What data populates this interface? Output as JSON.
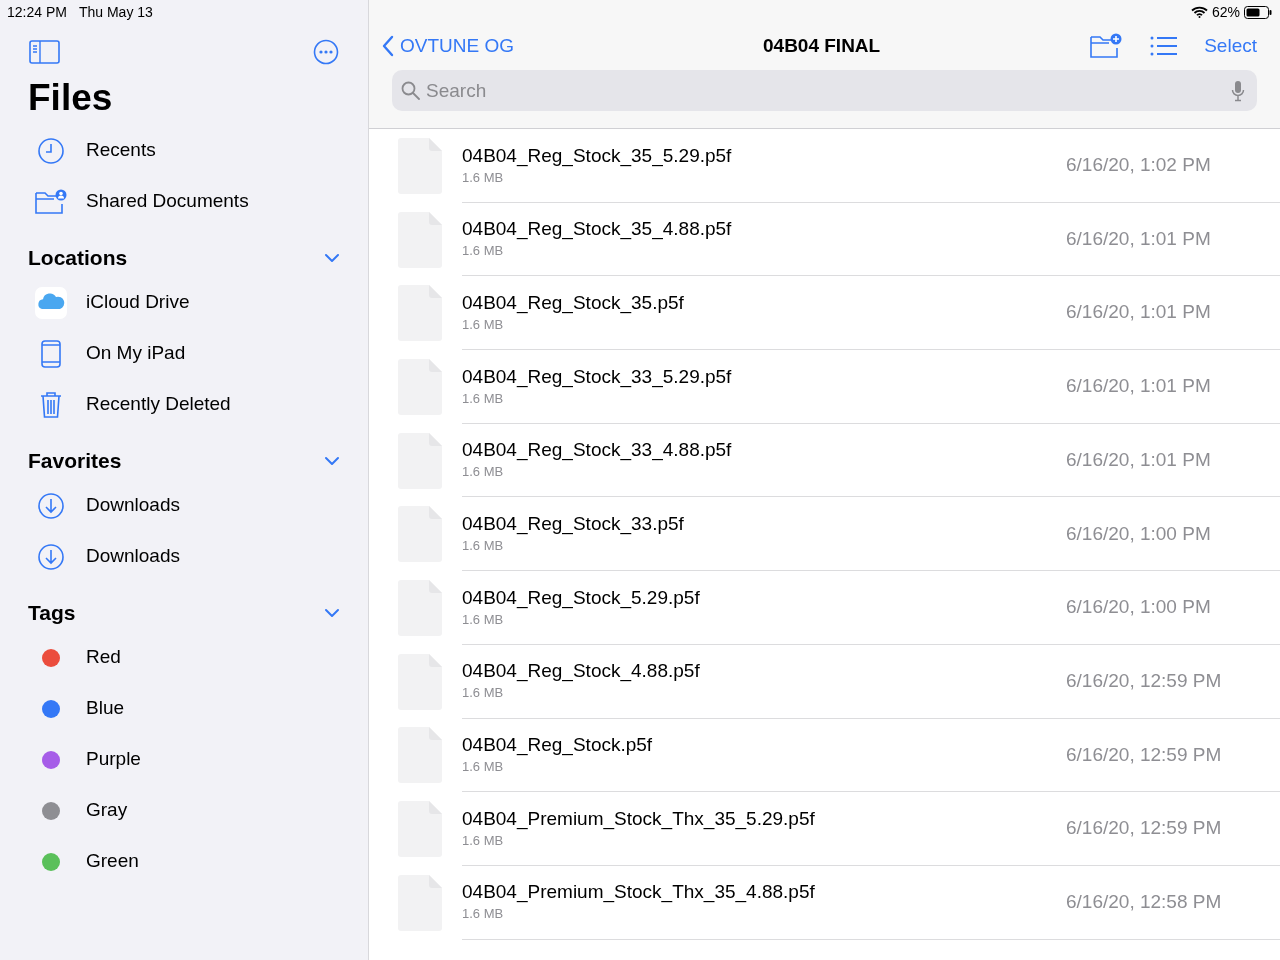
{
  "status_bar": {
    "time": "12:24 PM",
    "date": "Thu May 13",
    "battery": "62%"
  },
  "sidebar": {
    "title": "Files",
    "top_items": [
      {
        "kind": "clock",
        "label": "Recents"
      },
      {
        "kind": "shared",
        "label": "Shared Documents"
      }
    ],
    "sections": [
      {
        "title": "Locations",
        "expanded": true,
        "items": [
          {
            "kind": "icloud",
            "label": "iCloud Drive"
          },
          {
            "kind": "ipad",
            "label": "On My iPad"
          },
          {
            "kind": "trash",
            "label": "Recently Deleted"
          }
        ]
      },
      {
        "title": "Favorites",
        "expanded": true,
        "items": [
          {
            "kind": "download",
            "label": "Downloads"
          },
          {
            "kind": "download",
            "label": "Downloads"
          }
        ]
      },
      {
        "title": "Tags",
        "expanded": true,
        "items": [
          {
            "kind": "tag",
            "label": "Red",
            "color": "#eb4d3d"
          },
          {
            "kind": "tag",
            "label": "Blue",
            "color": "#3478f6"
          },
          {
            "kind": "tag",
            "label": "Purple",
            "color": "#a65de8"
          },
          {
            "kind": "tag",
            "label": "Gray",
            "color": "#8e8e93"
          },
          {
            "kind": "tag",
            "label": "Green",
            "color": "#5ac05a"
          }
        ]
      }
    ]
  },
  "navbar": {
    "back": "OVTUNE OG",
    "title": "04B04 FINAL",
    "select": "Select"
  },
  "search": {
    "placeholder": "Search"
  },
  "files": [
    {
      "name": "04B04_Reg_Stock_35_5.29.p5f",
      "size": "1.6 MB",
      "date": "6/16/20, 1:02 PM"
    },
    {
      "name": "04B04_Reg_Stock_35_4.88.p5f",
      "size": "1.6 MB",
      "date": "6/16/20, 1:01 PM"
    },
    {
      "name": "04B04_Reg_Stock_35.p5f",
      "size": "1.6 MB",
      "date": "6/16/20, 1:01 PM"
    },
    {
      "name": "04B04_Reg_Stock_33_5.29.p5f",
      "size": "1.6 MB",
      "date": "6/16/20, 1:01 PM"
    },
    {
      "name": "04B04_Reg_Stock_33_4.88.p5f",
      "size": "1.6 MB",
      "date": "6/16/20, 1:01 PM"
    },
    {
      "name": "04B04_Reg_Stock_33.p5f",
      "size": "1.6 MB",
      "date": "6/16/20, 1:00 PM"
    },
    {
      "name": "04B04_Reg_Stock_5.29.p5f",
      "size": "1.6 MB",
      "date": "6/16/20, 1:00 PM"
    },
    {
      "name": "04B04_Reg_Stock_4.88.p5f",
      "size": "1.6 MB",
      "date": "6/16/20, 12:59 PM"
    },
    {
      "name": "04B04_Reg_Stock.p5f",
      "size": "1.6 MB",
      "date": "6/16/20, 12:59 PM"
    },
    {
      "name": "04B04_Premium_Stock_Thx_35_5.29.p5f",
      "size": "1.6 MB",
      "date": "6/16/20, 12:59 PM"
    },
    {
      "name": "04B04_Premium_Stock_Thx_35_4.88.p5f",
      "size": "1.6 MB",
      "date": "6/16/20, 12:58 PM"
    }
  ]
}
